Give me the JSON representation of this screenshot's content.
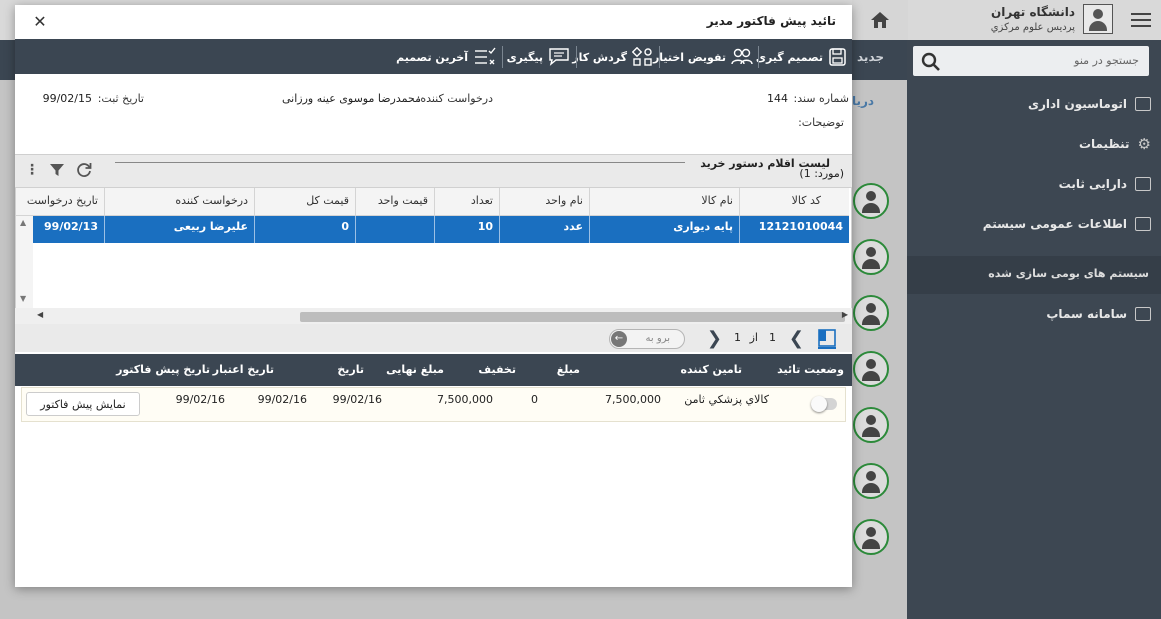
{
  "background": {
    "university": "دانشگاه تهران",
    "campus": "پردیس علوم مرکزي",
    "search_placeholder": "جستجو در منو",
    "new_tab": "جدید",
    "inbox_tab": "دریا",
    "sidebar": [
      {
        "label": "اتوماسیون اداری",
        "icon": "window-icon"
      },
      {
        "label": "تنظیمات",
        "icon": "gear-icon"
      },
      {
        "label": "دارایی ثابت",
        "icon": "window-icon"
      },
      {
        "label": "اطلاعات عمومی سیستم",
        "icon": "monitor-icon"
      }
    ],
    "localized_systems": "سیستم های بومی سازی شده",
    "samap": "سامانه سماپ"
  },
  "modal": {
    "title": "تائید پیش فاکتور مدیر",
    "close_symbol": "✕",
    "toolbar": [
      {
        "label": "تصمیم گیری",
        "icon": "save-decision-icon"
      },
      {
        "label": "تفویض اختیار",
        "icon": "delegate-icon"
      },
      {
        "label": "گردش کار",
        "icon": "workflow-icon"
      },
      {
        "label": "پیگیری",
        "icon": "chat-icon"
      },
      {
        "label": "آخرین تصمیم",
        "icon": "checklist-icon"
      }
    ],
    "doc_number_label": "شماره سند:",
    "doc_number": "144",
    "requester_label": "درخواست کننده:",
    "requester": "محمدرضا موسوی عینه ورزانی",
    "reg_date_label": "تاریخ ثبت:",
    "reg_date": "99/02/15",
    "desc_label": "توضیحات:"
  },
  "items_grid": {
    "title": "لیست اقلام دستور خرید",
    "count": "(مورد: 1)",
    "columns": [
      "کد کالا",
      "نام کالا",
      "نام واحد",
      "تعداد",
      "قیمت واحد",
      "قیمت کل",
      "درخواست کننده",
      "تاریخ درخواست"
    ],
    "row": [
      "12121010044",
      "پایه دیواری",
      "عدد",
      "10",
      "",
      "0",
      "علیرضا ربیعی",
      "99/02/13"
    ],
    "pager": {
      "page": "1",
      "of_label": "از",
      "total": "1",
      "go_label": "برو به"
    }
  },
  "invoice_grid": {
    "columns": [
      "وضعیت تائید",
      "تامین کننده",
      "مبلغ",
      "تخفیف",
      "مبلغ نهایی",
      "تاریخ",
      "تاریخ اعتبار",
      "تاریخ پیش فاکتور"
    ],
    "row": {
      "supplier": "کالاي پزشکي ثامن",
      "amount": "7,500,000",
      "discount": "0",
      "final_amount": "7,500,000",
      "date": "99/02/16",
      "valid_date": "99/02/16",
      "invoice_date": "99/02/16"
    },
    "approved": false,
    "show_button": "نمایش پیش فاکتور"
  }
}
